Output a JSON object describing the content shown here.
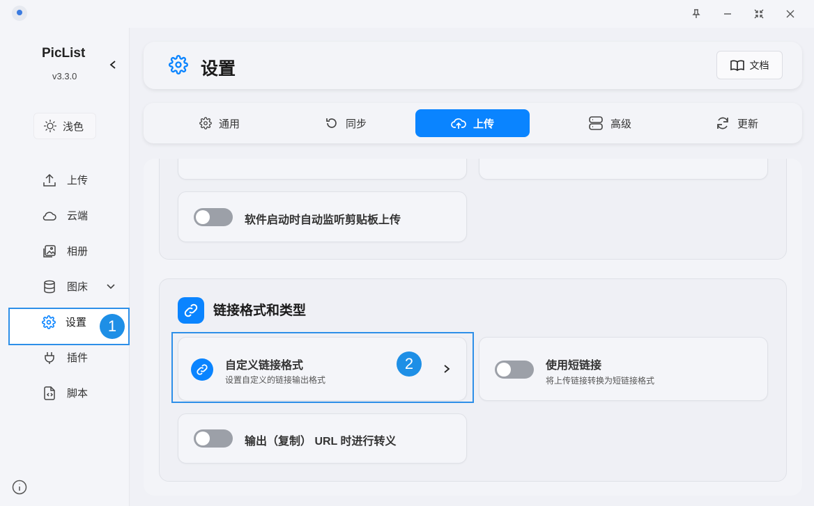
{
  "app": {
    "name": "PicList",
    "version": "v3.3.0"
  },
  "theme_button": {
    "label": "浅色"
  },
  "nav": {
    "items": [
      {
        "label": "上传",
        "icon": "upload-icon"
      },
      {
        "label": "云端",
        "icon": "cloud-icon"
      },
      {
        "label": "相册",
        "icon": "gallery-icon"
      },
      {
        "label": "图床",
        "icon": "database-icon"
      },
      {
        "label": "设置",
        "icon": "gear-icon"
      },
      {
        "label": "插件",
        "icon": "plug-icon"
      },
      {
        "label": "脚本",
        "icon": "script-icon"
      }
    ],
    "active": "设置"
  },
  "header": {
    "title": "设置",
    "doc_button": "文档"
  },
  "tabs": [
    {
      "label": "通用",
      "icon": "gear-icon"
    },
    {
      "label": "同步",
      "icon": "sync-icon"
    },
    {
      "label": "上传",
      "icon": "cloud-upload-icon",
      "active": true
    },
    {
      "label": "高级",
      "icon": "server-icon"
    },
    {
      "label": "更新",
      "icon": "refresh-icon"
    }
  ],
  "upload_section": {
    "clipboard_watch": {
      "label": "软件启动时自动监听剪贴板上传",
      "enabled": false
    }
  },
  "link_section": {
    "title": "链接格式和类型",
    "custom_format": {
      "label": "自定义链接格式",
      "desc": "设置自定义的链接输出格式"
    },
    "short_link": {
      "label": "使用短链接",
      "desc": "将上传链接转换为短链接格式",
      "enabled": false
    },
    "escape_url": {
      "label": "输出（复制） URL 时进行转义",
      "enabled": false
    }
  },
  "annotations": {
    "badge1": "1",
    "badge2": "2"
  },
  "colors": {
    "accent": "#0a84ff",
    "highlight": "#2d8fe8"
  }
}
